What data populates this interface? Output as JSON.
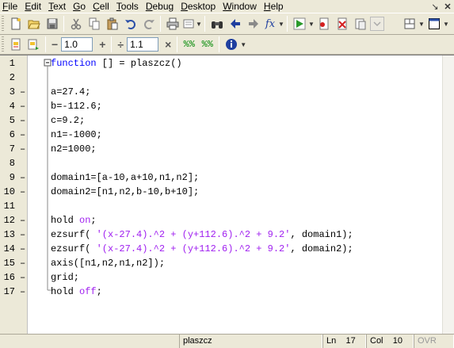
{
  "menu": [
    {
      "label": "File",
      "u": "F",
      "rest": "ile"
    },
    {
      "label": "Edit",
      "u": "E",
      "rest": "dit"
    },
    {
      "label": "Text",
      "u": "T",
      "rest": "ext"
    },
    {
      "label": "Go",
      "u": "G",
      "rest": "o"
    },
    {
      "label": "Cell",
      "u": "C",
      "rest": "ell"
    },
    {
      "label": "Tools",
      "u": "T",
      "rest": "ools"
    },
    {
      "label": "Debug",
      "u": "D",
      "rest": "ebug"
    },
    {
      "label": "Desktop",
      "u": "D",
      "rest": "esktop"
    },
    {
      "label": "Window",
      "u": "W",
      "rest": "indow"
    },
    {
      "label": "Help",
      "u": "H",
      "rest": "elp"
    }
  ],
  "toolbar2": {
    "minus_glyph": "−",
    "step_value": "1.0",
    "plus_glyph": "+",
    "divide_glyph": "÷",
    "scale_value": "1.1",
    "times_glyph": "×"
  },
  "icons": {
    "fx_label": "fx"
  },
  "editor": {
    "lines": [
      {
        "n": "1",
        "dash": "",
        "segments": [
          {
            "t": "function",
            "c": "kw"
          },
          {
            "t": " [] = plaszcz()",
            "c": ""
          }
        ]
      },
      {
        "n": "2",
        "dash": "",
        "segments": []
      },
      {
        "n": "3",
        "dash": "–",
        "segments": [
          {
            "t": "a=27.4;",
            "c": ""
          }
        ]
      },
      {
        "n": "4",
        "dash": "–",
        "segments": [
          {
            "t": "b=-112.6;",
            "c": ""
          }
        ]
      },
      {
        "n": "5",
        "dash": "–",
        "segments": [
          {
            "t": "c=9.2;",
            "c": ""
          }
        ]
      },
      {
        "n": "6",
        "dash": "–",
        "segments": [
          {
            "t": "n1=-1000;",
            "c": ""
          }
        ]
      },
      {
        "n": "7",
        "dash": "–",
        "segments": [
          {
            "t": "n2=1000;",
            "c": ""
          }
        ]
      },
      {
        "n": "8",
        "dash": "",
        "segments": []
      },
      {
        "n": "9",
        "dash": "–",
        "segments": [
          {
            "t": "domain1=[a-10,a+10,n1,n2];",
            "c": ""
          }
        ]
      },
      {
        "n": "10",
        "dash": "–",
        "segments": [
          {
            "t": "domain2=[n1,n2,b-10,b+10];",
            "c": ""
          }
        ]
      },
      {
        "n": "11",
        "dash": "",
        "segments": []
      },
      {
        "n": "12",
        "dash": "–",
        "segments": [
          {
            "t": "hold ",
            "c": ""
          },
          {
            "t": "on",
            "c": "str"
          },
          {
            "t": ";",
            "c": ""
          }
        ]
      },
      {
        "n": "13",
        "dash": "–",
        "segments": [
          {
            "t": "ezsurf( ",
            "c": ""
          },
          {
            "t": "'(x-27.4).^2 + (y+112.6).^2 + 9.2'",
            "c": "str"
          },
          {
            "t": ", domain1);",
            "c": ""
          }
        ]
      },
      {
        "n": "14",
        "dash": "–",
        "segments": [
          {
            "t": "ezsurf( ",
            "c": ""
          },
          {
            "t": "'(x-27.4).^2 + (y+112.6).^2 + 9.2'",
            "c": "str"
          },
          {
            "t": ", domain2);",
            "c": ""
          }
        ]
      },
      {
        "n": "15",
        "dash": "–",
        "segments": [
          {
            "t": "axis([n1,n2,n1,n2]);",
            "c": ""
          }
        ]
      },
      {
        "n": "16",
        "dash": "–",
        "segments": [
          {
            "t": "grid;",
            "c": ""
          }
        ]
      },
      {
        "n": "17",
        "dash": "–",
        "segments": [
          {
            "t": "hold ",
            "c": ""
          },
          {
            "t": "off",
            "c": "str"
          },
          {
            "t": ";",
            "c": ""
          }
        ]
      }
    ]
  },
  "status": {
    "function_name": "plaszcz",
    "ln_label": "Ln",
    "ln_value": "17",
    "col_label": "Col",
    "col_value": "10",
    "ovr": "OVR"
  },
  "colors": {
    "keyword": "#0000ff",
    "string": "#a020f0",
    "chrome": "#ece9d8"
  }
}
